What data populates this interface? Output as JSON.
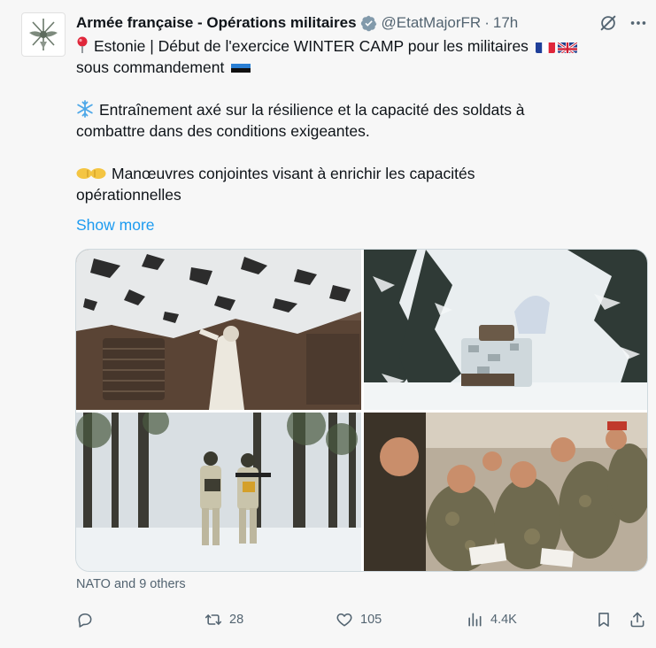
{
  "author": {
    "display_name": "Armée française - Opérations militaires",
    "handle": "@EtatMajorFR",
    "time": "17h",
    "separator": "·",
    "verified_icon": "verified-badge-gray"
  },
  "tweet": {
    "lines": [
      "Estonie | Début de l'exercice WINTER CAMP pour les militaires",
      "sous commandement",
      "Entraînement axé sur la résilience et la capacité des soldats à",
      "combattre dans des conditions exigeantes.",
      "Manœuvres conjointes visant à enrichir les capacités",
      "opérationnelles"
    ],
    "show_more": "Show more"
  },
  "liked_by": "NATO and 9 others",
  "metrics": {
    "replies": "",
    "reposts": "28",
    "likes": "105",
    "views": "4.4K"
  },
  "colors": {
    "background": "#f7f7f7",
    "text": "#0f1419",
    "secondary": "#536471",
    "link": "#1d9bf0"
  },
  "icons": {
    "pin": "round-pushpin-emoji",
    "snowflake": "snowflake-emoji",
    "fists": "left-right-facing-fist-emoji",
    "flags": [
      "france-flag",
      "uk-flag",
      "estonia-flag"
    ]
  }
}
